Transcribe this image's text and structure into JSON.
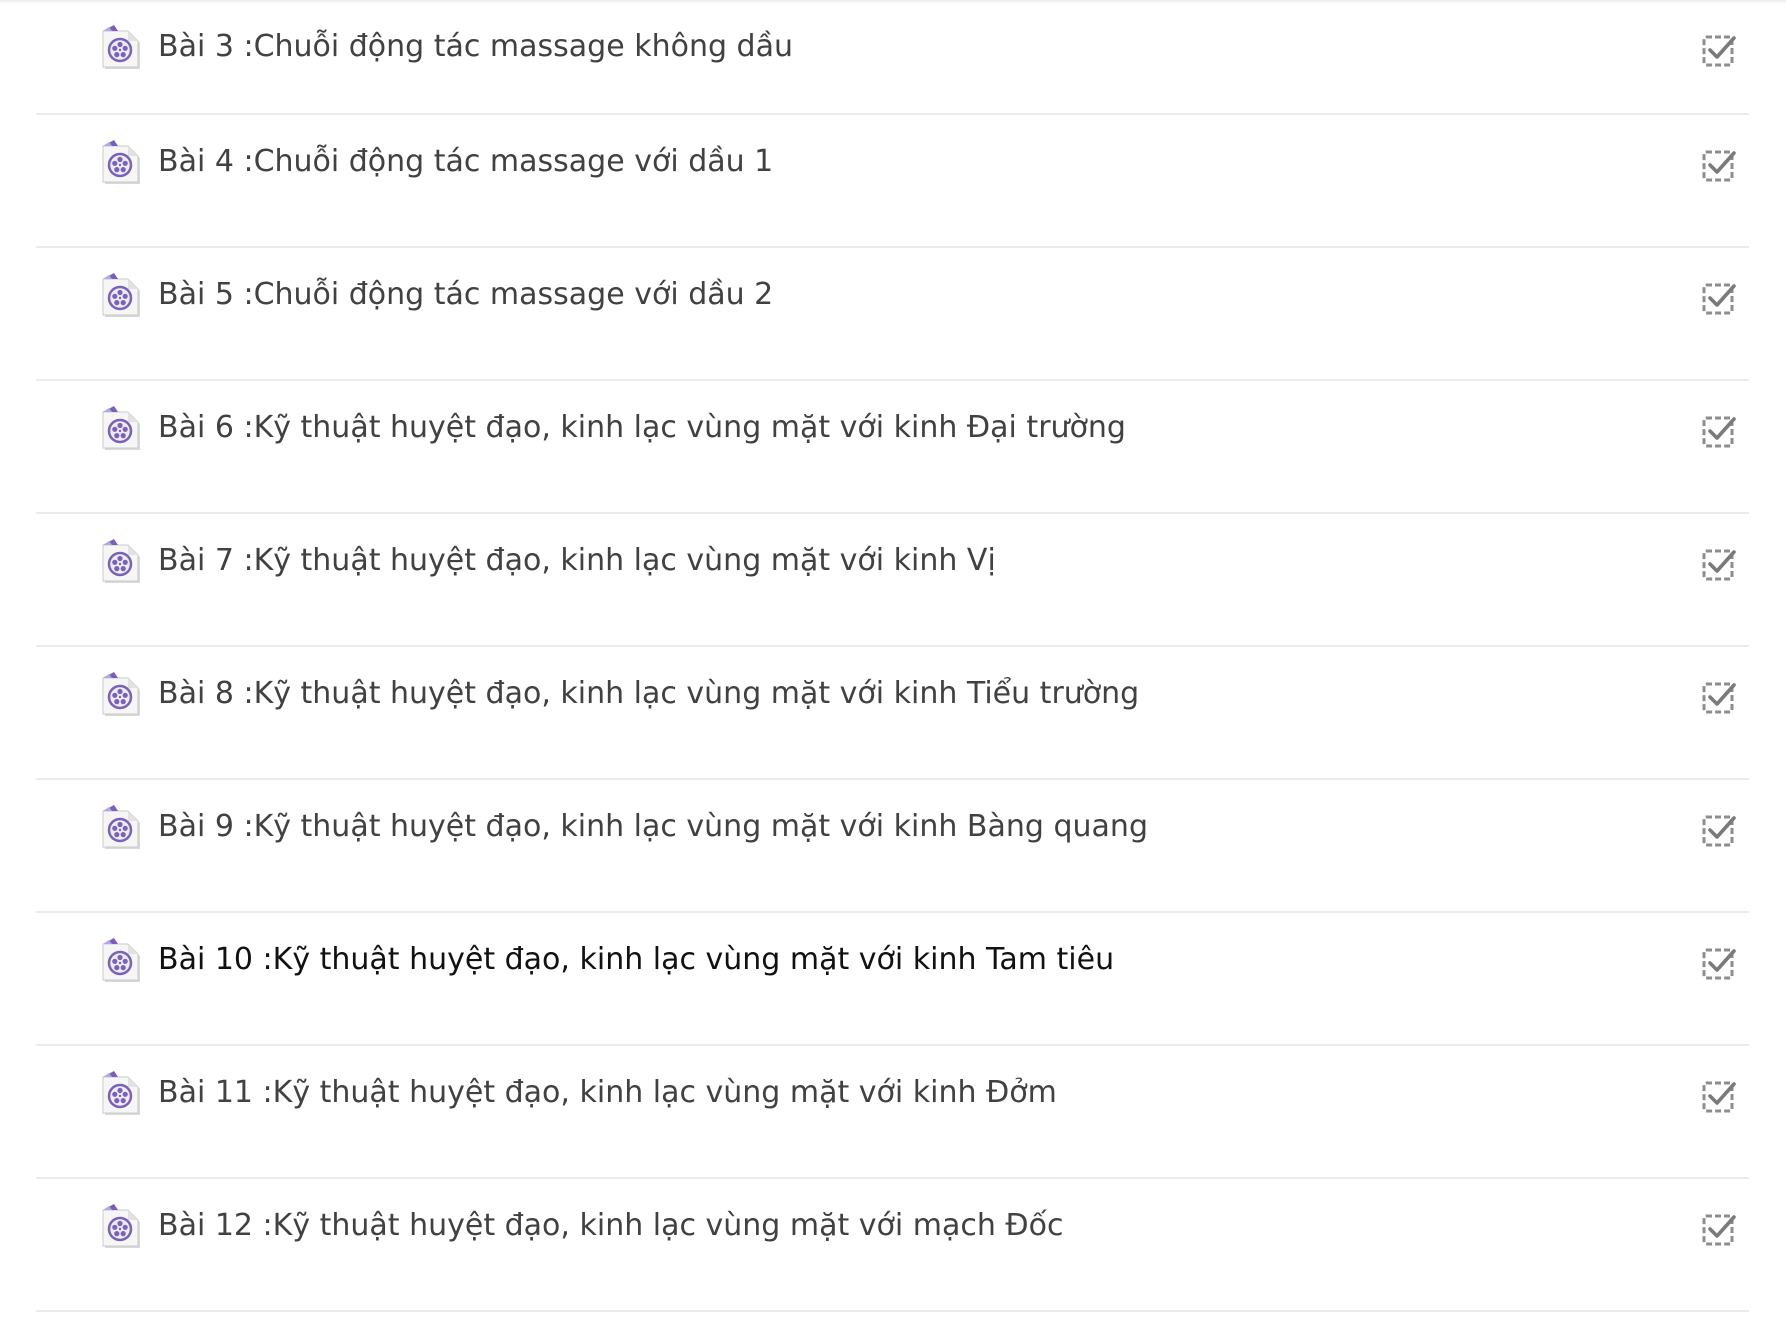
{
  "lessons": [
    {
      "title": "Bài 3 :Chuỗi động tác massage không dầu",
      "type_icon": "video-file-icon",
      "status_icon": "checkbox-checked-icon",
      "completed": true
    },
    {
      "title": "Bài 4 :Chuỗi động tác massage với dầu 1",
      "type_icon": "video-file-icon",
      "status_icon": "checkbox-checked-icon",
      "completed": true
    },
    {
      "title": "Bài 5 :Chuỗi động tác massage với dầu 2",
      "type_icon": "video-file-icon",
      "status_icon": "checkbox-checked-icon",
      "completed": true
    },
    {
      "title": "Bài 6 :Kỹ thuật huyệt đạo, kinh lạc vùng mặt với kinh Đại trường",
      "type_icon": "video-file-icon",
      "status_icon": "checkbox-checked-icon",
      "completed": true
    },
    {
      "title": "Bài 7 :Kỹ thuật huyệt đạo, kinh lạc vùng mặt với kinh Vị",
      "type_icon": "video-file-icon",
      "status_icon": "checkbox-checked-icon",
      "completed": true
    },
    {
      "title": "Bài 8 :Kỹ thuật huyệt đạo, kinh lạc vùng mặt với kinh Tiểu trường",
      "type_icon": "video-file-icon",
      "status_icon": "checkbox-checked-icon",
      "completed": true
    },
    {
      "title": "Bài 9 :Kỹ thuật huyệt đạo, kinh lạc vùng mặt với kinh Bàng quang",
      "type_icon": "video-file-icon",
      "status_icon": "checkbox-checked-icon",
      "completed": true
    },
    {
      "title": "Bài 10 :Kỹ thuật huyệt đạo, kinh lạc vùng mặt với kinh Tam tiêu",
      "type_icon": "video-file-icon",
      "status_icon": "checkbox-checked-icon",
      "completed": true,
      "active": true
    },
    {
      "title": "Bài 11 :Kỹ thuật huyệt đạo, kinh lạc vùng mặt với kinh Đởm",
      "type_icon": "video-file-icon",
      "status_icon": "checkbox-checked-icon",
      "completed": true
    },
    {
      "title": "Bài 12 :Kỹ thuật huyệt đạo, kinh lạc vùng mặt với mạch Đốc",
      "type_icon": "video-file-icon",
      "status_icon": "checkbox-checked-icon",
      "completed": true
    }
  ],
  "colors": {
    "text": "#414141",
    "active_text": "#111111",
    "divider": "#ebebeb",
    "icon_purple": "#6b4fa6",
    "check_gray": "#8a8a8a"
  }
}
